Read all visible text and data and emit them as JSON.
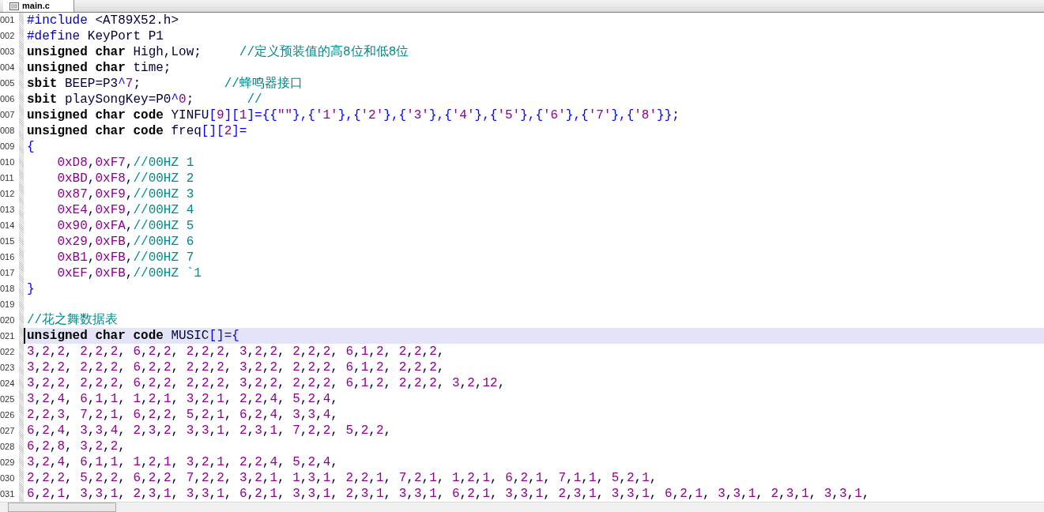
{
  "tabs": [
    {
      "label": "main.c",
      "selected": true
    }
  ],
  "editor": {
    "lines": [
      {
        "number": "001",
        "selected": false,
        "segments": [
          {
            "kind": "pp",
            "text": "#include"
          },
          {
            "kind": "id",
            "text": " <AT89X52.h>"
          }
        ]
      },
      {
        "number": "002",
        "selected": false,
        "segments": [
          {
            "kind": "pp",
            "text": "#define"
          },
          {
            "kind": "id",
            "text": " KeyPort P1"
          }
        ]
      },
      {
        "number": "003",
        "selected": false,
        "segments": [
          {
            "kind": "kw",
            "text": "unsigned char"
          },
          {
            "kind": "id",
            "text": " High,Low;     "
          },
          {
            "kind": "cmt",
            "text": "//定义预装值的高8位和低8位"
          }
        ]
      },
      {
        "number": "004",
        "selected": false,
        "segments": [
          {
            "kind": "kw",
            "text": "unsigned char"
          },
          {
            "kind": "id",
            "text": " time;"
          }
        ]
      },
      {
        "number": "005",
        "selected": false,
        "segments": [
          {
            "kind": "kw",
            "text": "sbit"
          },
          {
            "kind": "id",
            "text": " BEEP=P3"
          },
          {
            "kind": "op",
            "text": "^"
          },
          {
            "kind": "num",
            "text": "7"
          },
          {
            "kind": "id",
            "text": ";           "
          },
          {
            "kind": "cmt",
            "text": "//蜂鸣器接口"
          }
        ]
      },
      {
        "number": "006",
        "selected": false,
        "segments": [
          {
            "kind": "kw",
            "text": "sbit"
          },
          {
            "kind": "id",
            "text": " playSongKey=P0"
          },
          {
            "kind": "op",
            "text": "^"
          },
          {
            "kind": "num",
            "text": "0"
          },
          {
            "kind": "id",
            "text": ";       "
          },
          {
            "kind": "cmt",
            "text": "//"
          }
        ]
      },
      {
        "number": "007",
        "selected": false,
        "segments": [
          {
            "kind": "kw",
            "text": "unsigned char code"
          },
          {
            "kind": "id",
            "text": " YINFU"
          },
          {
            "kind": "op",
            "text": "["
          },
          {
            "kind": "num",
            "text": "9"
          },
          {
            "kind": "op",
            "text": "]["
          },
          {
            "kind": "num",
            "text": "1"
          },
          {
            "kind": "op",
            "text": "]={{"
          },
          {
            "kind": "num",
            "text": "\"\""
          },
          {
            "kind": "op",
            "text": "},{"
          },
          {
            "kind": "num",
            "text": "'1'"
          },
          {
            "kind": "op",
            "text": "},{"
          },
          {
            "kind": "num",
            "text": "'2'"
          },
          {
            "kind": "op",
            "text": "},{"
          },
          {
            "kind": "num",
            "text": "'3'"
          },
          {
            "kind": "op",
            "text": "},{"
          },
          {
            "kind": "num",
            "text": "'4'"
          },
          {
            "kind": "op",
            "text": "},{"
          },
          {
            "kind": "num",
            "text": "'5'"
          },
          {
            "kind": "op",
            "text": "},{"
          },
          {
            "kind": "num",
            "text": "'6'"
          },
          {
            "kind": "op",
            "text": "},{"
          },
          {
            "kind": "num",
            "text": "'7'"
          },
          {
            "kind": "op",
            "text": "},{"
          },
          {
            "kind": "num",
            "text": "'8'"
          },
          {
            "kind": "op",
            "text": "}};"
          }
        ]
      },
      {
        "number": "008",
        "selected": false,
        "segments": [
          {
            "kind": "kw",
            "text": "unsigned char code"
          },
          {
            "kind": "id",
            "text": " freq"
          },
          {
            "kind": "op",
            "text": "[]["
          },
          {
            "kind": "num",
            "text": "2"
          },
          {
            "kind": "op",
            "text": "]="
          }
        ]
      },
      {
        "number": "009",
        "selected": false,
        "segments": [
          {
            "kind": "op",
            "text": "{"
          }
        ]
      },
      {
        "number": "010",
        "selected": false,
        "segments": [
          {
            "kind": "data",
            "text": "    0xD8,0xF7,"
          },
          {
            "kind": "cmt",
            "text": "//00HZ 1"
          }
        ]
      },
      {
        "number": "011",
        "selected": false,
        "segments": [
          {
            "kind": "data",
            "text": "    0xBD,0xF8,"
          },
          {
            "kind": "cmt",
            "text": "//00HZ 2"
          }
        ]
      },
      {
        "number": "012",
        "selected": false,
        "segments": [
          {
            "kind": "data",
            "text": "    0x87,0xF9,"
          },
          {
            "kind": "cmt",
            "text": "//00HZ 3"
          }
        ]
      },
      {
        "number": "013",
        "selected": false,
        "segments": [
          {
            "kind": "data",
            "text": "    0xE4,0xF9,"
          },
          {
            "kind": "cmt",
            "text": "//00HZ 4"
          }
        ]
      },
      {
        "number": "014",
        "selected": false,
        "segments": [
          {
            "kind": "data",
            "text": "    0x90,0xFA,"
          },
          {
            "kind": "cmt",
            "text": "//00HZ 5"
          }
        ]
      },
      {
        "number": "015",
        "selected": false,
        "segments": [
          {
            "kind": "data",
            "text": "    0x29,0xFB,"
          },
          {
            "kind": "cmt",
            "text": "//00HZ 6"
          }
        ]
      },
      {
        "number": "016",
        "selected": false,
        "segments": [
          {
            "kind": "data",
            "text": "    0xB1,0xFB,"
          },
          {
            "kind": "cmt",
            "text": "//00HZ 7"
          }
        ]
      },
      {
        "number": "017",
        "selected": false,
        "segments": [
          {
            "kind": "data",
            "text": "    0xEF,0xFB,"
          },
          {
            "kind": "cmt",
            "text": "//00HZ `1"
          }
        ]
      },
      {
        "number": "018",
        "selected": false,
        "segments": [
          {
            "kind": "op",
            "text": "}"
          }
        ]
      },
      {
        "number": "019",
        "selected": false
      },
      {
        "number": "020",
        "selected": false,
        "segments": [
          {
            "kind": "cmt",
            "text": "//花之舞数据表"
          }
        ]
      },
      {
        "number": "021",
        "selected": true,
        "segments": [
          {
            "kind": "kw",
            "text": "unsigned char code"
          },
          {
            "kind": "id",
            "text": " MUSIC"
          },
          {
            "kind": "op",
            "text": "[]={"
          }
        ]
      },
      {
        "number": "022",
        "selected": false,
        "segments": [
          {
            "kind": "data",
            "text": "3,2,2, 2,2,2, 6,2,2, 2,2,2, 3,2,2, 2,2,2, 6,1,2, 2,2,2,"
          }
        ]
      },
      {
        "number": "023",
        "selected": false,
        "segments": [
          {
            "kind": "data",
            "text": "3,2,2, 2,2,2, 6,2,2, 2,2,2, 3,2,2, 2,2,2, 6,1,2, 2,2,2,"
          }
        ]
      },
      {
        "number": "024",
        "selected": false,
        "segments": [
          {
            "kind": "data",
            "text": "3,2,2, 2,2,2, 6,2,2, 2,2,2, 3,2,2, 2,2,2, 6,1,2, 2,2,2, 3,2,12,"
          }
        ]
      },
      {
        "number": "025",
        "selected": false,
        "segments": [
          {
            "kind": "data",
            "text": "3,2,4, 6,1,1, 1,2,1, 3,2,1, 2,2,4, 5,2,4,"
          }
        ]
      },
      {
        "number": "026",
        "selected": false,
        "segments": [
          {
            "kind": "data",
            "text": "2,2,3, 7,2,1, 6,2,2, 5,2,1, 6,2,4, 3,3,4,"
          }
        ]
      },
      {
        "number": "027",
        "selected": false,
        "segments": [
          {
            "kind": "data",
            "text": "6,2,4, 3,3,4, 2,3,2, 3,3,1, 2,3,1, 7,2,2, 5,2,2,"
          }
        ]
      },
      {
        "number": "028",
        "selected": false,
        "segments": [
          {
            "kind": "data",
            "text": "6,2,8, 3,2,2,"
          }
        ]
      },
      {
        "number": "029",
        "selected": false,
        "segments": [
          {
            "kind": "data",
            "text": "3,2,4, 6,1,1, 1,2,1, 3,2,1, 2,2,4, 5,2,4,"
          }
        ]
      },
      {
        "number": "030",
        "selected": false,
        "segments": [
          {
            "kind": "data",
            "text": "2,2,2, 5,2,2, 6,2,2, 7,2,2, 3,2,1, 1,3,1, 2,2,1, 7,2,1, 1,2,1, 6,2,1, 7,1,1, 5,2,1,"
          }
        ]
      },
      {
        "number": "031",
        "selected": false,
        "segments": [
          {
            "kind": "data",
            "text": "6,2,1, 3,3,1, 2,3,1, 3,3,1, 6,2,1, 3,3,1, 2,3,1, 3,3,1, 6,2,1, 3,3,1, 2,3,1, 3,3,1, 6,2,1, 3,3,1, 2,3,1, 3,3,1,"
          }
        ]
      }
    ]
  }
}
